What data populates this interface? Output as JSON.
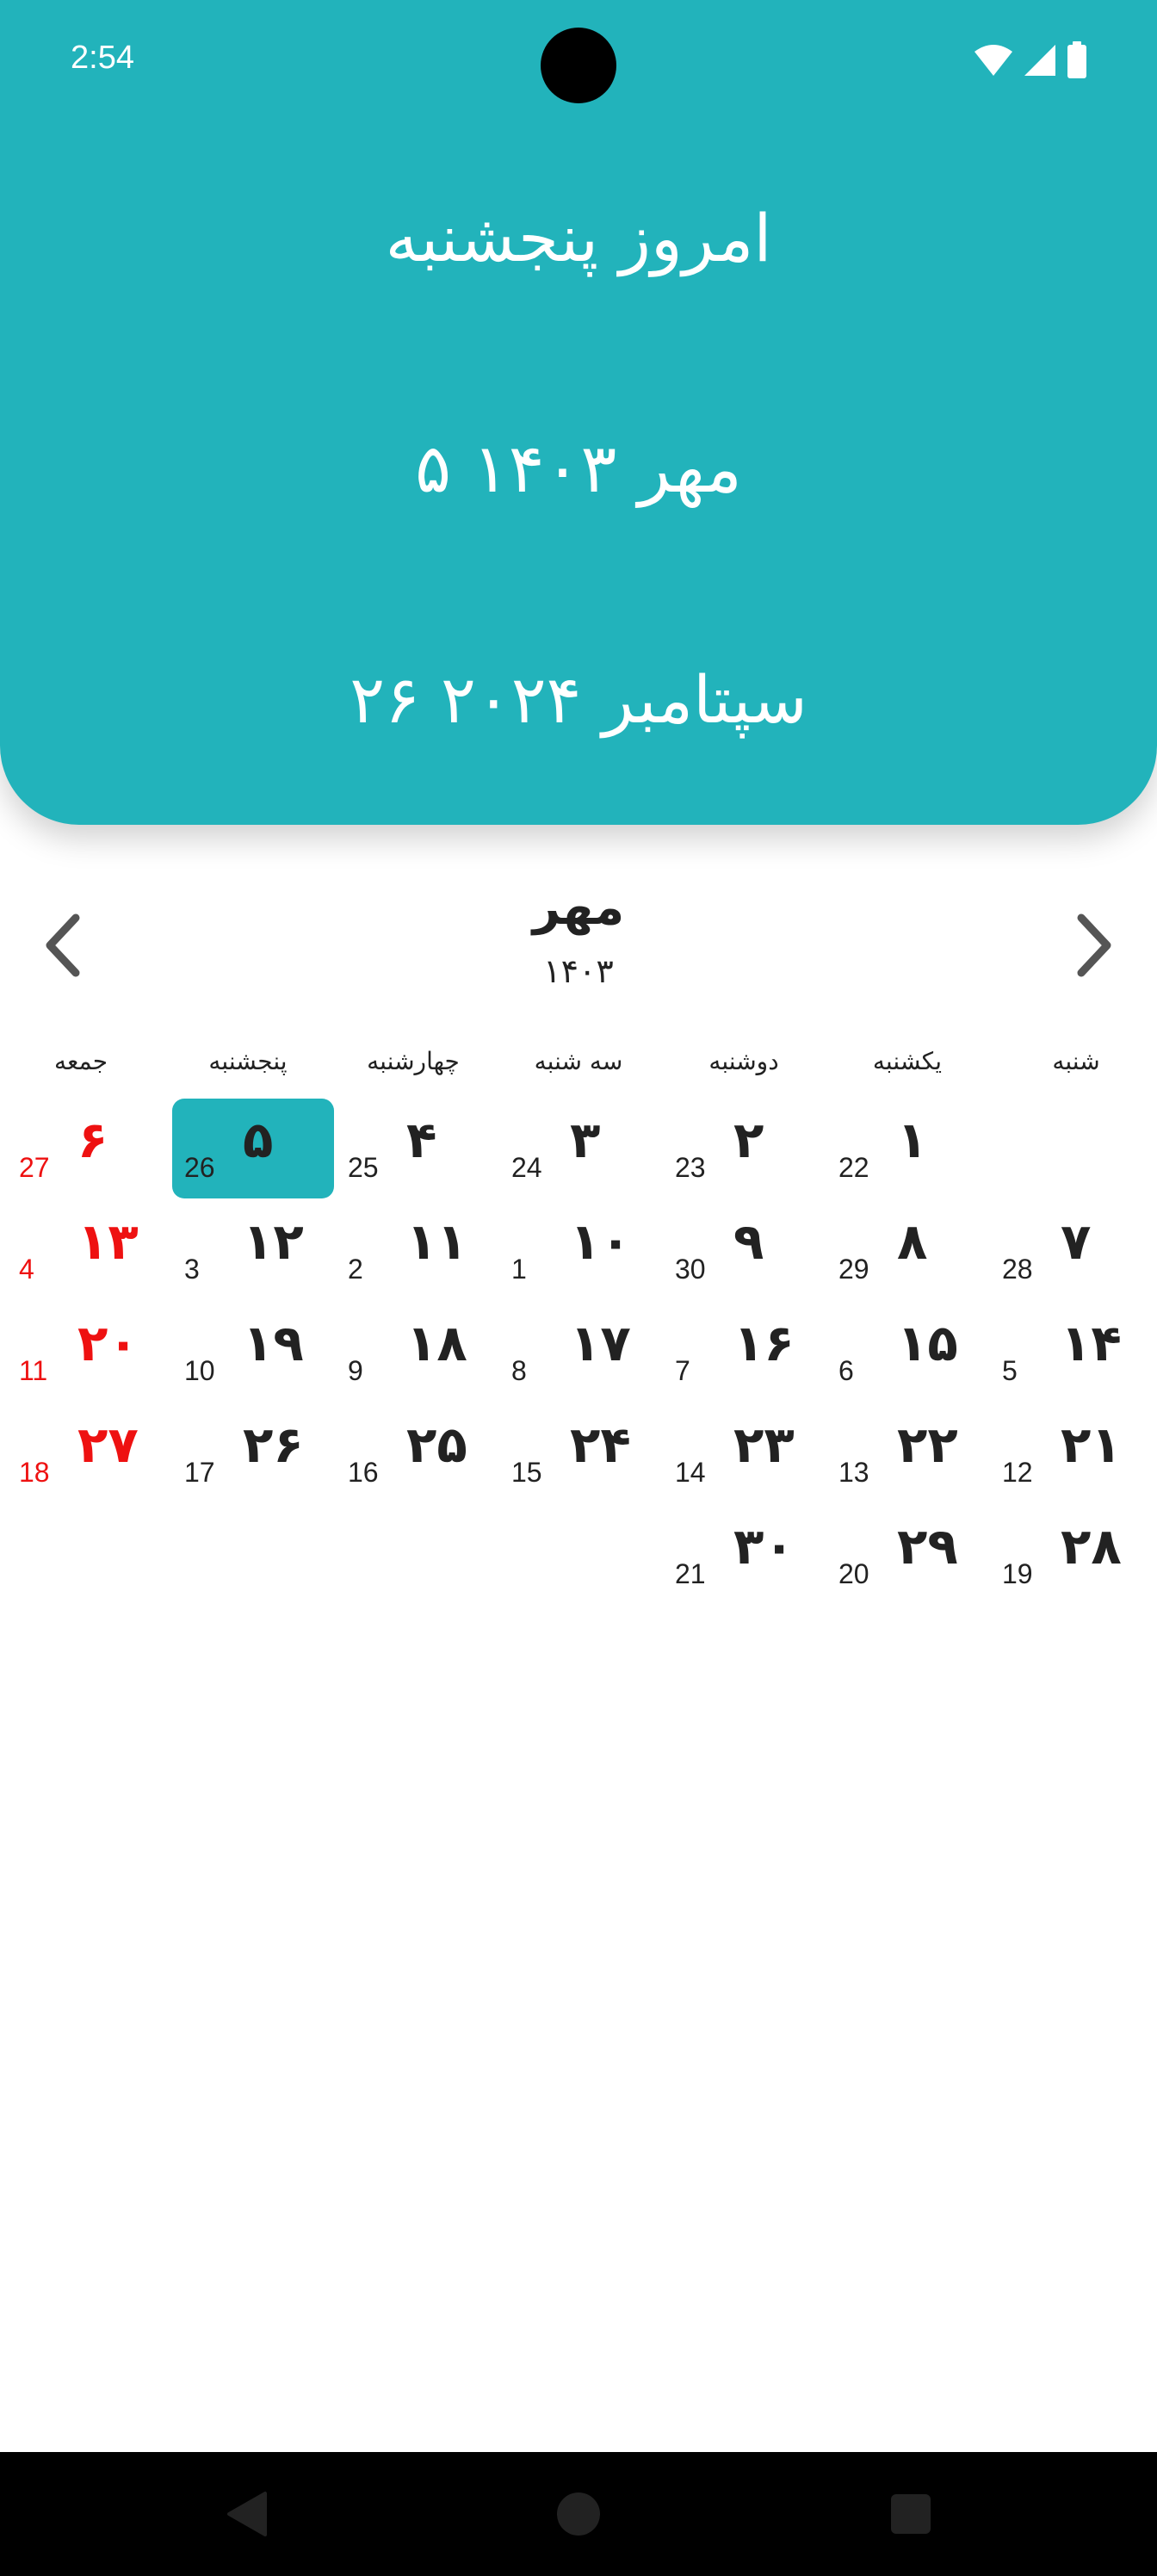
{
  "status_bar": {
    "time": "2:54",
    "icons": [
      "wifi-icon",
      "cellular-signal-icon",
      "battery-icon"
    ]
  },
  "header": {
    "today_label": "امروز پنجشنبه",
    "jalali_date": "۵ مهر ۱۴۰۳",
    "gregorian_date": "۲۶ سپتامبر ۲۰۲۴",
    "background_color": "#22b3bb"
  },
  "month_nav": {
    "month_name": "مهر",
    "year": "۱۴۰۳",
    "prev_icon": "chevron-left-icon",
    "next_icon": "chevron-right-icon"
  },
  "weekdays": [
    "شنبه",
    "یکشنبه",
    "دوشنبه",
    "سه شنبه",
    "چهارشنبه",
    "پنجشنبه",
    "جمعه"
  ],
  "weeks": [
    [
      null,
      {
        "fa": "۱",
        "greg": "22"
      },
      {
        "fa": "۲",
        "greg": "23"
      },
      {
        "fa": "۳",
        "greg": "24"
      },
      {
        "fa": "۴",
        "greg": "25"
      },
      {
        "fa": "۵",
        "greg": "26",
        "selected": true
      },
      {
        "fa": "۶",
        "greg": "27",
        "holiday": true
      }
    ],
    [
      {
        "fa": "۷",
        "greg": "28"
      },
      {
        "fa": "۸",
        "greg": "29"
      },
      {
        "fa": "۹",
        "greg": "30"
      },
      {
        "fa": "۱۰",
        "greg": "1"
      },
      {
        "fa": "۱۱",
        "greg": "2"
      },
      {
        "fa": "۱۲",
        "greg": "3"
      },
      {
        "fa": "۱۳",
        "greg": "4",
        "holiday": true
      }
    ],
    [
      {
        "fa": "۱۴",
        "greg": "5"
      },
      {
        "fa": "۱۵",
        "greg": "6"
      },
      {
        "fa": "۱۶",
        "greg": "7"
      },
      {
        "fa": "۱۷",
        "greg": "8"
      },
      {
        "fa": "۱۸",
        "greg": "9"
      },
      {
        "fa": "۱۹",
        "greg": "10"
      },
      {
        "fa": "۲۰",
        "greg": "11",
        "holiday": true
      }
    ],
    [
      {
        "fa": "۲۱",
        "greg": "12"
      },
      {
        "fa": "۲۲",
        "greg": "13"
      },
      {
        "fa": "۲۳",
        "greg": "14"
      },
      {
        "fa": "۲۴",
        "greg": "15"
      },
      {
        "fa": "۲۵",
        "greg": "16"
      },
      {
        "fa": "۲۶",
        "greg": "17"
      },
      {
        "fa": "۲۷",
        "greg": "18",
        "holiday": true
      }
    ],
    [
      {
        "fa": "۲۸",
        "greg": "19"
      },
      {
        "fa": "۲۹",
        "greg": "20"
      },
      {
        "fa": "۳۰",
        "greg": "21"
      },
      null,
      null,
      null,
      null
    ]
  ],
  "colors": {
    "accent": "#22b3bb",
    "holiday": "#ee1111",
    "text": "#222222"
  },
  "system_nav": {
    "back_icon": "back-triangle-icon",
    "home_icon": "home-circle-icon",
    "recents_icon": "recents-square-icon"
  }
}
